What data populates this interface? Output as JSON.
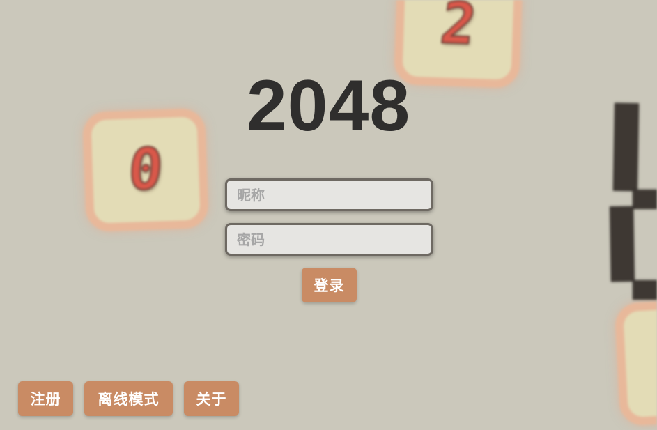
{
  "app": {
    "title": "2048"
  },
  "background_tiles": [
    {
      "digit": "0"
    },
    {
      "digit": "2"
    }
  ],
  "login_form": {
    "nickname_placeholder": "昵称",
    "password_placeholder": "密码",
    "login_label": "登录"
  },
  "footer_buttons": {
    "register_label": "注册",
    "offline_label": "离线模式",
    "about_label": "关于"
  },
  "colors": {
    "background": "#cbc8bb",
    "accent_button": "#c98b64",
    "title_text": "#2f2e2d",
    "tile_fill": "#e3dcb6",
    "tile_border": "#e8b89a",
    "digit_red": "#d9584a"
  }
}
